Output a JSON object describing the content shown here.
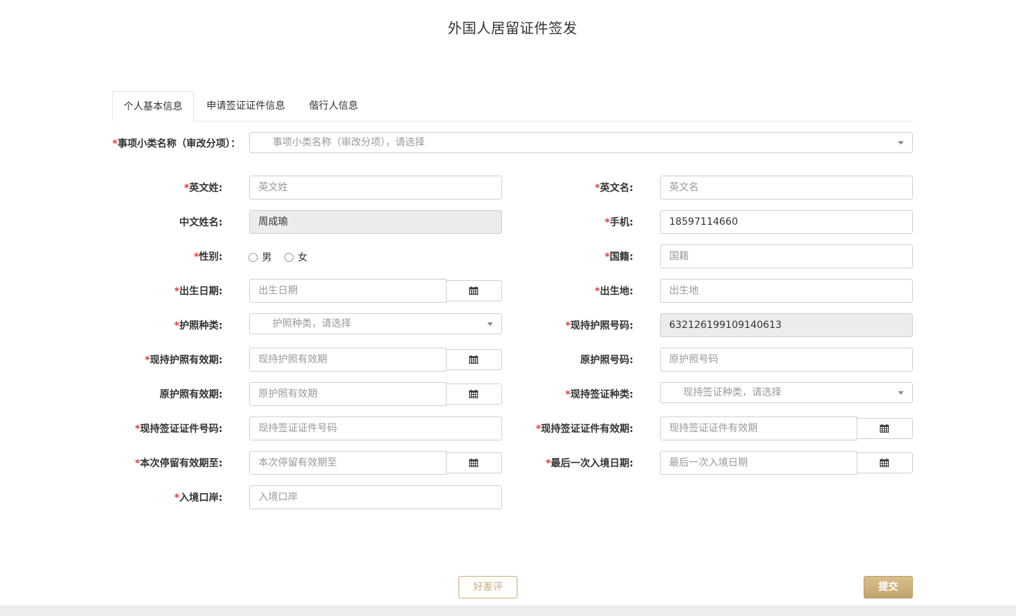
{
  "page": {
    "title": "外国人居留证件签发"
  },
  "tabs": [
    {
      "label": "个人基本信息"
    },
    {
      "label": "申请签证证件信息"
    },
    {
      "label": "偕行人信息"
    }
  ],
  "form": {
    "required_mark": "*",
    "item_category": {
      "label": "事项小类名称（审改分项）：",
      "placeholder": "事项小类名称（审改分项），请选择"
    },
    "english_surname": {
      "label": "英文姓:",
      "placeholder": "英文姓"
    },
    "english_given_name": {
      "label": "英文名:",
      "placeholder": "英文名"
    },
    "chinese_name": {
      "label": "中文姓名:",
      "value": "周成瑜"
    },
    "mobile": {
      "label": "手机:",
      "value": "18597114660"
    },
    "gender": {
      "label": "性别:",
      "options": [
        "男",
        "女"
      ]
    },
    "nationality": {
      "label": "国籍:",
      "placeholder": "国籍"
    },
    "birth_date": {
      "label": "出生日期:",
      "placeholder": "出生日期"
    },
    "birth_place": {
      "label": "出生地:",
      "placeholder": "出生地"
    },
    "passport_type": {
      "label": "护照种类:",
      "placeholder": "护照种类，请选择"
    },
    "passport_number": {
      "label": "现持护照号码:",
      "value": "632126199109140613"
    },
    "passport_validity": {
      "label": "现持护照有效期:",
      "placeholder": "现持护照有效期"
    },
    "former_passport_number": {
      "label": "原护照号码:",
      "placeholder": "原护照号码"
    },
    "former_passport_validity": {
      "label": "原护照有效期:",
      "placeholder": "原护照有效期"
    },
    "visa_type": {
      "label": "现持签证种类:",
      "placeholder": "现持签证种类，请选择"
    },
    "visa_number": {
      "label": "现持签证证件号码:",
      "placeholder": "现持签证证件号码"
    },
    "visa_validity": {
      "label": "现持签证证件有效期:",
      "placeholder": "现持签证证件有效期"
    },
    "stay_valid_until": {
      "label": "本次停留有效期至:",
      "placeholder": "本次停留有效期至"
    },
    "last_entry_date": {
      "label": "最后一次入境日期:",
      "placeholder": "最后一次入境日期"
    },
    "entry_port": {
      "label": "入境口岸:",
      "placeholder": "入境口岸"
    }
  },
  "actions": {
    "rating_label": "好差评",
    "submit_label": "提交"
  },
  "icons": {
    "calendar": "calendar-icon",
    "dropdown": "chevron-down-icon"
  },
  "colors": {
    "accent": "#c9ad7a",
    "required": "#e23b3b"
  }
}
